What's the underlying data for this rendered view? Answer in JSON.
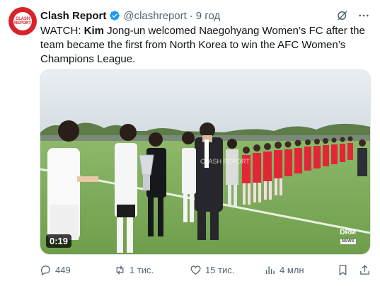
{
  "account": {
    "name": "Clash Report",
    "handle": "@clashreport",
    "separator": "·",
    "time": "9 год",
    "avatar_line1": "CLASH",
    "avatar_line2": "REPORT",
    "brand_color": "#d8232a"
  },
  "tweet": {
    "prefix": "WATCH: ",
    "bold": "Kim",
    "text": " Jong-un welcomed Naegohyang Women’s FC after the team became the first from North Korea to win the AFC Women’s Champions League."
  },
  "video": {
    "duration": "0:19",
    "watermark": "DRM",
    "watermark_sub": "NEWS",
    "overlay_text": "CLASH REPORT"
  },
  "actions": {
    "replies": "449",
    "reposts": "1 тис.",
    "likes": "15 тис.",
    "views": "4 млн"
  },
  "icons": [
    "grok-icon",
    "more-icon",
    "reply-icon",
    "repost-icon",
    "like-icon",
    "views-icon",
    "bookmark-icon",
    "share-icon",
    "verified-badge-icon"
  ],
  "colors": {
    "verified": "#1d9bf0",
    "secondary_text": "#536471",
    "jersey_red": "#e32636"
  }
}
